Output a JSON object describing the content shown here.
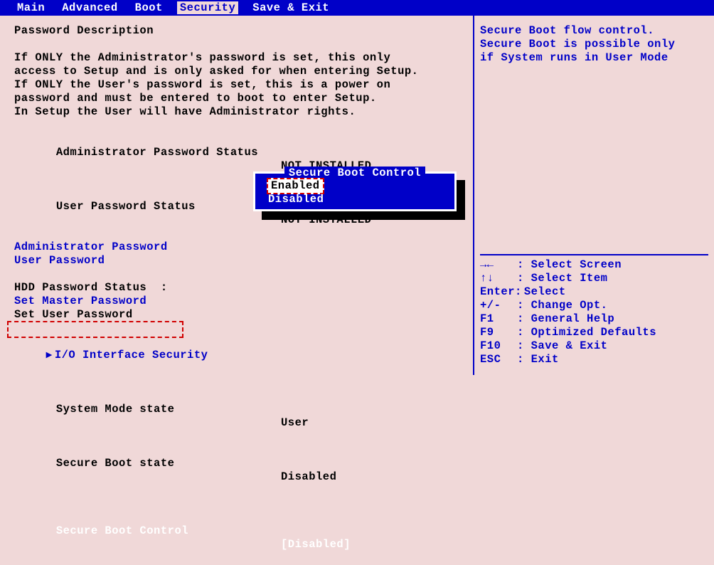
{
  "menubar": {
    "items": [
      "Main",
      "Advanced",
      "Boot",
      "Security",
      "Save & Exit"
    ],
    "active_index": 3
  },
  "main": {
    "heading": "Password Description",
    "desc_lines": [
      "If ONLY the Administrator's password is set, this only",
      "access to Setup and is only asked for when entering Setup.",
      "If ONLY the User's password is set, this is a power on",
      "password and must be entered to boot to enter Setup.",
      "In Setup the User will have Administrator rights."
    ],
    "rows": [
      {
        "label": "Administrator Password Status",
        "value": "NOT INSTALLED",
        "link": false
      },
      {
        "label": "User Password Status",
        "value": "NOT INSTALLED",
        "link": false
      },
      {
        "label": "Administrator Password",
        "value": "",
        "link": true
      },
      {
        "label": "User Password",
        "value": "",
        "link": true
      }
    ],
    "hdd_label": "HDD Password Status  :",
    "set_master": "Set Master Password",
    "set_user": "Set User Password",
    "io_submenu": "I/O Interface Security",
    "sys_mode": {
      "label": "System Mode state",
      "value": "User"
    },
    "secure_state": {
      "label": "Secure Boot state",
      "value": "Disabled"
    },
    "secure_ctrl": {
      "label": "Secure Boot Control",
      "value": "[Disabled]"
    }
  },
  "popup": {
    "title": "Secure Boot Control",
    "options": [
      "Enabled",
      "Disabled"
    ],
    "selected_index": 0
  },
  "help": {
    "lines": [
      "Secure Boot flow control.",
      "Secure Boot is possible only",
      "if System runs in User Mode"
    ]
  },
  "hotkeys": [
    {
      "key": "→←",
      "label": "Select Screen"
    },
    {
      "key": "↑↓",
      "label": "Select Item"
    },
    {
      "key": "Enter:",
      "label": "Select"
    },
    {
      "key": "+/-",
      "label": "Change Opt."
    },
    {
      "key": "F1",
      "label": "General Help"
    },
    {
      "key": "F9",
      "label": "Optimized Defaults"
    },
    {
      "key": "F10",
      "label": "Save & Exit"
    },
    {
      "key": "ESC",
      "label": "Exit"
    }
  ]
}
